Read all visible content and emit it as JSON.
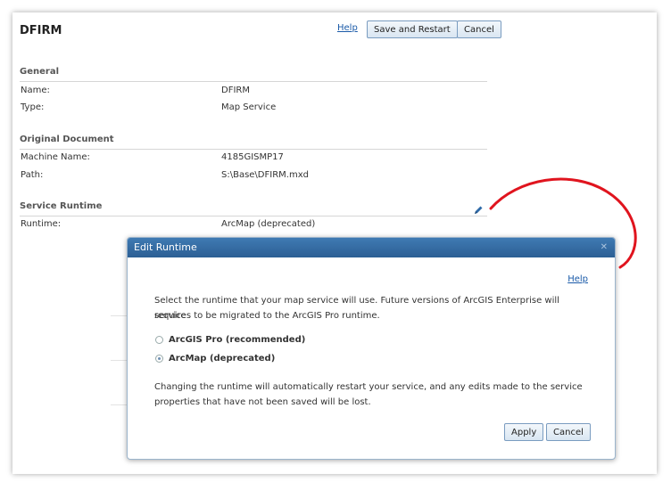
{
  "page": {
    "title": "DFIRM",
    "help_label": "Help",
    "save_restart_label": "Save and Restart",
    "cancel_label": "Cancel"
  },
  "general": {
    "section_title": "General",
    "rows": [
      {
        "label": "Name:",
        "value": "DFIRM"
      },
      {
        "label": "Type:",
        "value": "Map Service"
      }
    ]
  },
  "original_document": {
    "section_title": "Original Document",
    "rows": [
      {
        "label": "Machine Name:",
        "value": "4185GISMP17"
      },
      {
        "label": "Path:",
        "value": "S:\\Base\\DFIRM.mxd"
      }
    ]
  },
  "service_runtime": {
    "section_title": "Service Runtime",
    "rows": [
      {
        "label": "Runtime:",
        "value": "ArcMap (deprecated)"
      }
    ]
  },
  "dialog": {
    "title": "Edit Runtime",
    "help_label": "Help",
    "intro_line1": "Select the runtime that your map service will use. Future versions of ArcGIS Enterprise will require",
    "intro_line2": "services to be migrated to the ArcGIS Pro runtime.",
    "options": [
      {
        "label": "ArcGIS Pro (recommended)",
        "checked": false
      },
      {
        "label": "ArcMap (deprecated)",
        "checked": true
      }
    ],
    "warning_line1": "Changing the runtime will automatically restart your service, and any edits made to the service",
    "warning_line2": "properties that have not been saved will be lost.",
    "apply_label": "Apply",
    "cancel_label": "Cancel"
  },
  "colors": {
    "header_blue": "#2c5f94",
    "link_blue": "#1a5aa8",
    "annotation_red": "#e0141e"
  }
}
